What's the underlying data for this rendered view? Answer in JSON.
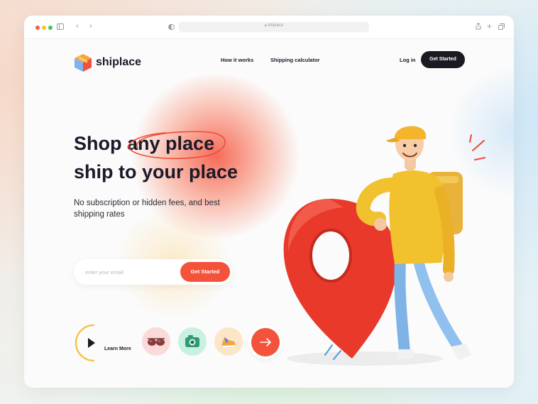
{
  "browser": {
    "url": "shiplace",
    "dots": [
      "#f65a4e",
      "#f8c12d",
      "#3ec94e"
    ]
  },
  "brand": {
    "name": "shiplace"
  },
  "nav": {
    "how_it_works": "How it works",
    "shipping_calculator": "Shipping calculator",
    "login": "Log in",
    "get_started": "Get Started"
  },
  "hero": {
    "line1_start": "Shop",
    "line1_highlight": "any place",
    "line2": "ship to your place",
    "subtitle": "No subscription or hidden fees, and best shipping rates"
  },
  "signup": {
    "placeholder": "enter your email",
    "button": "Get Started"
  },
  "actions": {
    "learn_more": "Learn More",
    "items": [
      {
        "icon": "sunglasses-icon",
        "bg": "#fbdada"
      },
      {
        "icon": "camera-icon",
        "bg": "#c9f1df"
      },
      {
        "icon": "sneaker-icon",
        "bg": "#fde6c8"
      }
    ],
    "arrow_icon": "arrow-right-icon"
  },
  "colors": {
    "accent": "#f5523c",
    "dark": "#1a1a22",
    "text": "#1a1a2a"
  }
}
